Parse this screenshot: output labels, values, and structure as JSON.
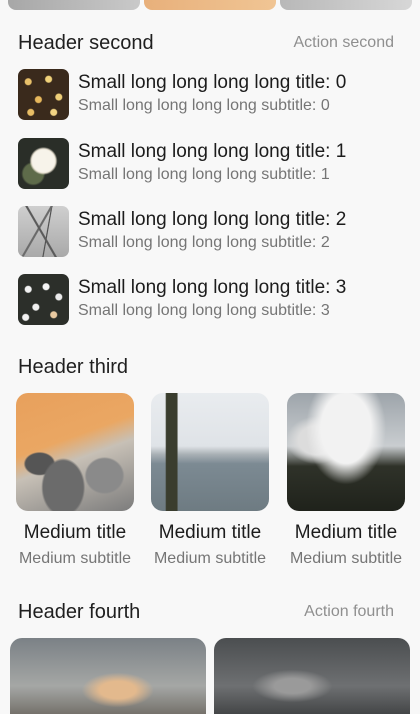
{
  "section_second": {
    "title": "Header second",
    "action": "Action second",
    "items": [
      {
        "title": "Small long long long long title: 0",
        "subtitle": "Small long long long long subtitle: 0"
      },
      {
        "title": "Small long long long long title: 1",
        "subtitle": "Small long long long long subtitle: 1"
      },
      {
        "title": "Small long long long long title: 2",
        "subtitle": "Small long long long long subtitle: 2"
      },
      {
        "title": "Small long long long long title: 3",
        "subtitle": "Small long long long long subtitle: 3"
      }
    ]
  },
  "section_third": {
    "title": "Header third",
    "cards": [
      {
        "title": "Medium title",
        "subtitle": "Medium subtitle"
      },
      {
        "title": "Medium title",
        "subtitle": "Medium subtitle"
      },
      {
        "title": "Medium title",
        "subtitle": "Medium subtitle"
      }
    ]
  },
  "section_fourth": {
    "title": "Header fourth",
    "action": "Action fourth"
  }
}
